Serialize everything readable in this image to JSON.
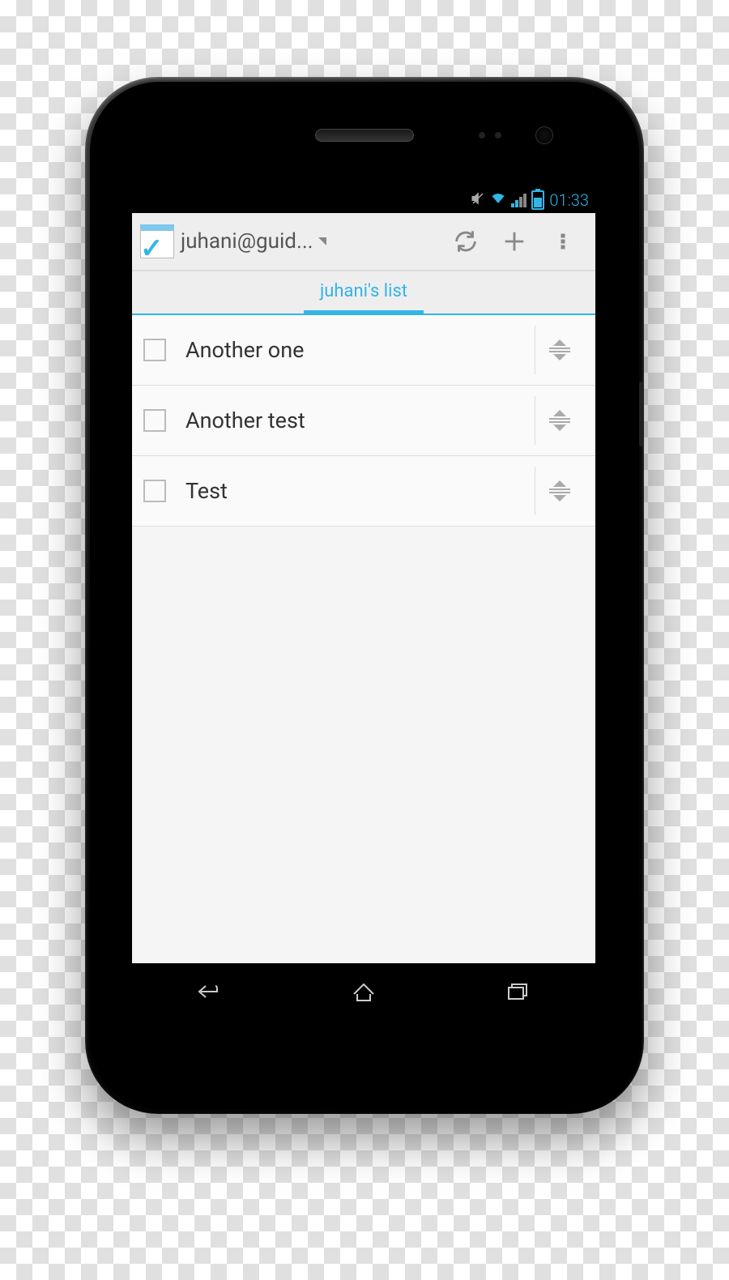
{
  "statusbar": {
    "time": "01:33"
  },
  "actionbar": {
    "account": "juhani@guid..."
  },
  "tabs": {
    "active": "juhani's list"
  },
  "items": [
    {
      "label": "Another one",
      "checked": false
    },
    {
      "label": "Another test",
      "checked": false
    },
    {
      "label": "Test",
      "checked": false
    }
  ]
}
